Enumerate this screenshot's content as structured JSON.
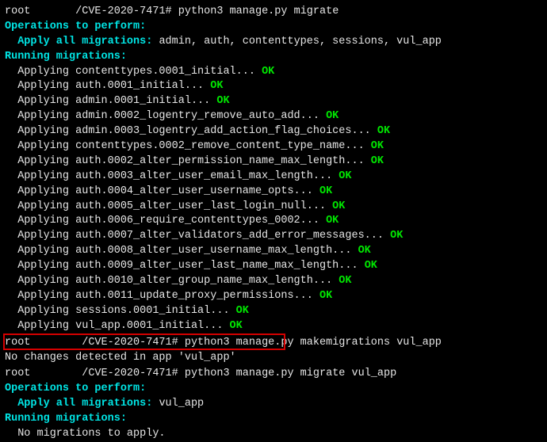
{
  "prompt1": {
    "user": "root",
    "redacted1": "███████",
    "path": "/CVE-2020-7471#",
    "cmd": "python3 manage.py migrate"
  },
  "ops1": {
    "header": "Operations to perform:",
    "apply_label": "Apply all migrations: ",
    "apply_list": "admin, auth, contenttypes, sessions, vul_app"
  },
  "running1": "Running migrations:",
  "migs": [
    {
      "pre": "  Applying ",
      "name": "contenttypes.0001_initial",
      "dots": "... ",
      "ok": "OK"
    },
    {
      "pre": "  Applying ",
      "name": "auth.0001_initial",
      "dots": "... ",
      "ok": "OK"
    },
    {
      "pre": "  Applying ",
      "name": "admin.0001_initial",
      "dots": "... ",
      "ok": "OK"
    },
    {
      "pre": "  Applying ",
      "name": "admin.0002_logentry_remove_auto_add",
      "dots": "... ",
      "ok": "OK"
    },
    {
      "pre": "  Applying ",
      "name": "admin.0003_logentry_add_action_flag_choices",
      "dots": "... ",
      "ok": "OK"
    },
    {
      "pre": "  Applying ",
      "name": "contenttypes.0002_remove_content_type_name",
      "dots": "... ",
      "ok": "OK"
    },
    {
      "pre": "  Applying ",
      "name": "auth.0002_alter_permission_name_max_length",
      "dots": "... ",
      "ok": "OK"
    },
    {
      "pre": "  Applying ",
      "name": "auth.0003_alter_user_email_max_length",
      "dots": "... ",
      "ok": "OK"
    },
    {
      "pre": "  Applying ",
      "name": "auth.0004_alter_user_username_opts",
      "dots": "... ",
      "ok": "OK"
    },
    {
      "pre": "  Applying ",
      "name": "auth.0005_alter_user_last_login_null",
      "dots": "... ",
      "ok": "OK"
    },
    {
      "pre": "  Applying ",
      "name": "auth.0006_require_contenttypes_0002",
      "dots": "... ",
      "ok": "OK"
    },
    {
      "pre": "  Applying ",
      "name": "auth.0007_alter_validators_add_error_messages",
      "dots": "... ",
      "ok": "OK"
    },
    {
      "pre": "  Applying ",
      "name": "auth.0008_alter_user_username_max_length",
      "dots": "... ",
      "ok": "OK"
    },
    {
      "pre": "  Applying ",
      "name": "auth.0009_alter_user_last_name_max_length",
      "dots": "... ",
      "ok": "OK"
    },
    {
      "pre": "  Applying ",
      "name": "auth.0010_alter_group_name_max_length",
      "dots": "... ",
      "ok": "OK"
    },
    {
      "pre": "  Applying ",
      "name": "auth.0011_update_proxy_permissions",
      "dots": "... ",
      "ok": "OK"
    },
    {
      "pre": "  Applying ",
      "name": "sessions.0001_initial",
      "dots": "... ",
      "ok": "OK"
    },
    {
      "pre": "  Applying ",
      "name": "vul_app.0001_initial",
      "dots": "... ",
      "ok": "OK"
    }
  ],
  "prompt2": {
    "user": "root",
    "redacted1": "████████",
    "path": "/CVE-2020-7471#",
    "cmd": "python3 manage.py makemigrations vul_app"
  },
  "no_changes": "No changes detected in app 'vul_app'",
  "prompt3": {
    "user": "root",
    "redacted1": "████████",
    "path": "/CVE-2020-7471#",
    "cmd": "python3 manage.py migrate vul_app"
  },
  "ops2": {
    "header": "Operations to perform:",
    "apply_label": "Apply all migrations: ",
    "apply_list": "vul_app"
  },
  "running2": "Running migrations:",
  "no_migs": "  No migrations to apply."
}
